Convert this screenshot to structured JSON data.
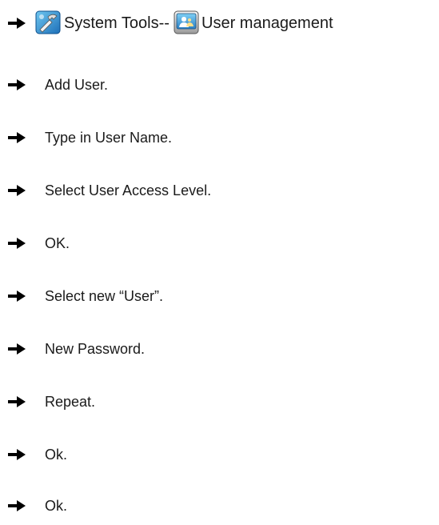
{
  "steps": {
    "first": {
      "part1": "System Tools--",
      "part2": "User management",
      "icon1": "system-tools-icon",
      "icon2": "user-management-icon"
    },
    "items": [
      "Add User.",
      "Type in User Name.",
      "Select User Access Level.",
      "OK.",
      "Select new “User”.",
      "New Password.",
      "Repeat.",
      "Ok.",
      "Ok."
    ],
    "bullet_icon": "right-arrow-icon"
  }
}
